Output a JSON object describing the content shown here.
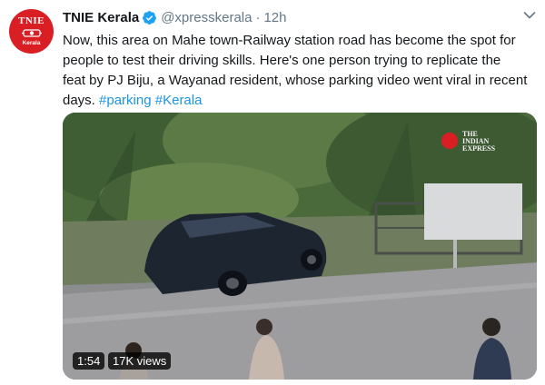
{
  "tweet": {
    "avatar": {
      "line1": "TNIE",
      "line2": "Kerala"
    },
    "author_name": "TNIE Kerala",
    "handle": "@xpresskerala",
    "separator": "·",
    "time": "12h",
    "text": [
      "Now, this area on Mahe town-Railway station road has become the spot for",
      "people to test their driving skills. Here's one person trying to replicate the",
      "feat by PJ Biju, a Wayanad resident, whose parking video went viral in recent"
    ],
    "last_line_text": "days. ",
    "hashtags": [
      "#parking",
      "#Kerala"
    ],
    "media": {
      "watermark_line1": "THE",
      "watermark_line2": "INDIAN",
      "watermark_line3": "EXPRESS",
      "duration": "1:54",
      "views": "17K views"
    }
  },
  "colors": {
    "brand_red": "#d91e24",
    "verified_blue": "#1da1f2",
    "hashtag_blue": "#1b95e0",
    "secondary_text": "#657786"
  },
  "icons": [
    "verified-badge-icon",
    "caret-down-icon"
  ]
}
